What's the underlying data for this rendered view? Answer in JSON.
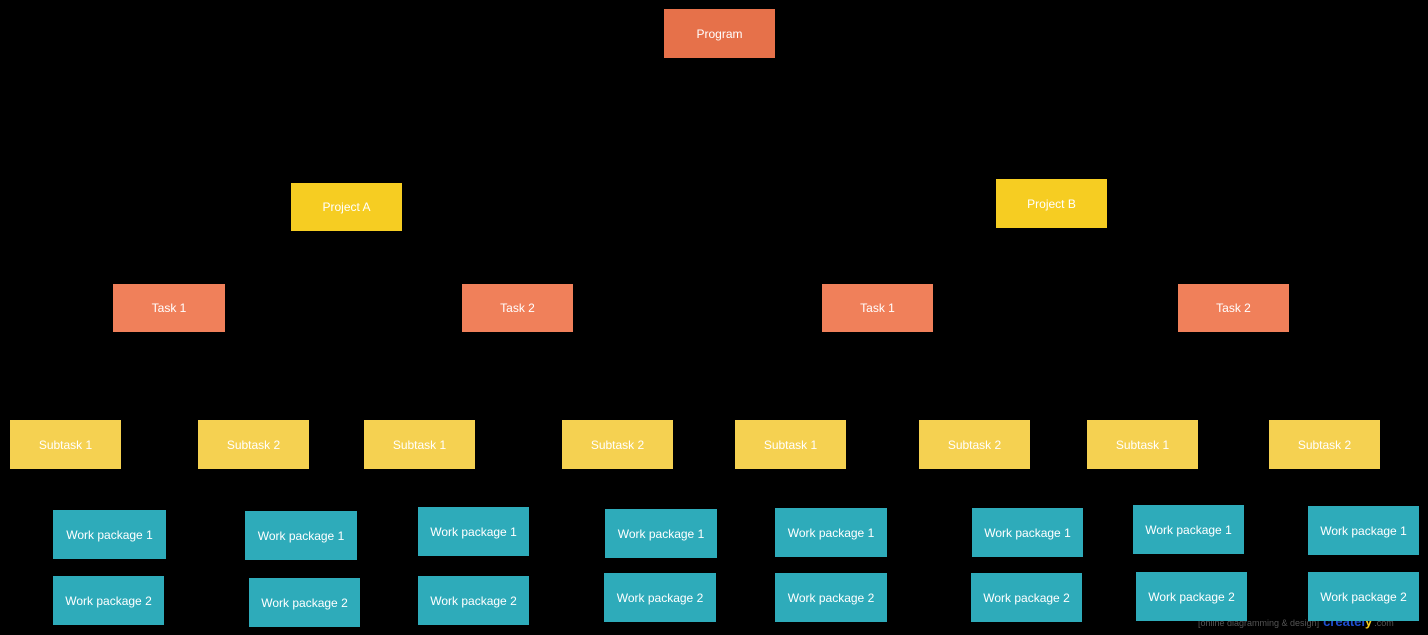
{
  "colors": {
    "program": "#e6714a",
    "project": "#f6cd22",
    "task": "#f0805a",
    "subtask": "#f5d151",
    "work_package": "#2eabba",
    "background": "#000000"
  },
  "nodes": [
    {
      "id": "program",
      "label": "Program",
      "level": "program"
    },
    {
      "id": "project-a",
      "label": "Project A",
      "level": "project"
    },
    {
      "id": "project-b",
      "label": "Project B",
      "level": "project"
    },
    {
      "id": "a-task-1",
      "label": "Task 1",
      "level": "task"
    },
    {
      "id": "a-task-2",
      "label": "Task 2",
      "level": "task"
    },
    {
      "id": "b-task-1",
      "label": "Task 1",
      "level": "task"
    },
    {
      "id": "b-task-2",
      "label": "Task 2",
      "level": "task"
    },
    {
      "id": "a1-sub-1",
      "label": "Subtask 1",
      "level": "subtask"
    },
    {
      "id": "a1-sub-2",
      "label": "Subtask 2",
      "level": "subtask"
    },
    {
      "id": "a2-sub-1",
      "label": "Subtask 1",
      "level": "subtask"
    },
    {
      "id": "a2-sub-2",
      "label": "Subtask 2",
      "level": "subtask"
    },
    {
      "id": "b1-sub-1",
      "label": "Subtask 1",
      "level": "subtask"
    },
    {
      "id": "b1-sub-2",
      "label": "Subtask 2",
      "level": "subtask"
    },
    {
      "id": "b2-sub-1",
      "label": "Subtask 1",
      "level": "subtask"
    },
    {
      "id": "b2-sub-2",
      "label": "Subtask 2",
      "level": "subtask"
    },
    {
      "id": "wp-1-1",
      "label": "Work package 1",
      "level": "work_package"
    },
    {
      "id": "wp-2-1",
      "label": "Work package 1",
      "level": "work_package"
    },
    {
      "id": "wp-3-1",
      "label": "Work package 1",
      "level": "work_package"
    },
    {
      "id": "wp-4-1",
      "label": "Work package 1",
      "level": "work_package"
    },
    {
      "id": "wp-5-1",
      "label": "Work package 1",
      "level": "work_package"
    },
    {
      "id": "wp-6-1",
      "label": "Work package 1",
      "level": "work_package"
    },
    {
      "id": "wp-7-1",
      "label": "Work package 1",
      "level": "work_package"
    },
    {
      "id": "wp-8-1",
      "label": "Work package 1",
      "level": "work_package"
    },
    {
      "id": "wp-1-2",
      "label": "Work package 2",
      "level": "work_package"
    },
    {
      "id": "wp-2-2",
      "label": "Work package 2",
      "level": "work_package"
    },
    {
      "id": "wp-3-2",
      "label": "Work package 2",
      "level": "work_package"
    },
    {
      "id": "wp-4-2",
      "label": "Work package 2",
      "level": "work_package"
    },
    {
      "id": "wp-5-2",
      "label": "Work package 2",
      "level": "work_package"
    },
    {
      "id": "wp-6-2",
      "label": "Work package 2",
      "level": "work_package"
    },
    {
      "id": "wp-7-2",
      "label": "Work package 2",
      "level": "work_package"
    },
    {
      "id": "wp-8-2",
      "label": "Work package 2",
      "level": "work_package"
    }
  ],
  "watermark": {
    "tagline": "[online diagramming & design]",
    "brand_main": "createl",
    "brand_y": "y",
    "domain": ".com"
  }
}
